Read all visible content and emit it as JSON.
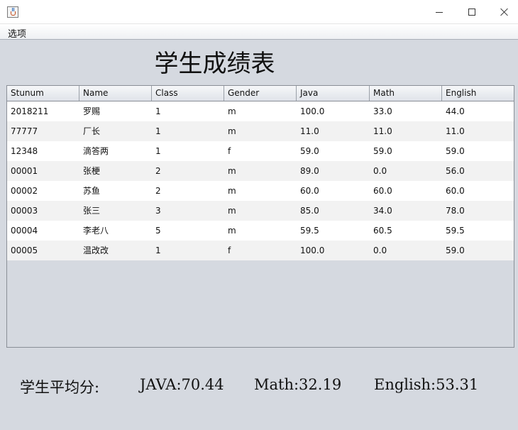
{
  "window": {
    "title": ""
  },
  "menu": {
    "items": [
      "选项"
    ]
  },
  "page": {
    "title": "学生成绩表"
  },
  "table": {
    "columns": [
      "Stunum",
      "Name",
      "Class",
      "Gender",
      "Java",
      "Math",
      "English"
    ],
    "rows": [
      [
        "2018211",
        "罗赐",
        "1",
        "m",
        "100.0",
        "33.0",
        "44.0"
      ],
      [
        "77777",
        "厂长",
        "1",
        "m",
        "11.0",
        "11.0",
        "11.0"
      ],
      [
        "12348",
        "滴答两",
        "1",
        "f",
        "59.0",
        "59.0",
        "59.0"
      ],
      [
        "00001",
        "张梗",
        "2",
        "m",
        "89.0",
        "0.0",
        "56.0"
      ],
      [
        "00002",
        "苏鱼",
        "2",
        "m",
        "60.0",
        "60.0",
        "60.0"
      ],
      [
        "00003",
        "张三",
        "3",
        "m",
        "85.0",
        "34.0",
        "78.0"
      ],
      [
        "00004",
        "李老八",
        "5",
        "m",
        "59.5",
        "60.5",
        "59.5"
      ],
      [
        "00005",
        "温改改",
        "1",
        "f",
        "100.0",
        "0.0",
        "59.0"
      ]
    ]
  },
  "averages": {
    "label": "学生平均分:",
    "java": "JAVA:70.44",
    "math": "Math:32.19",
    "english": "English:53.31"
  },
  "icons": {
    "app": "java-icon",
    "minimize": "minimize-icon",
    "maximize": "maximize-icon",
    "close": "close-icon"
  }
}
